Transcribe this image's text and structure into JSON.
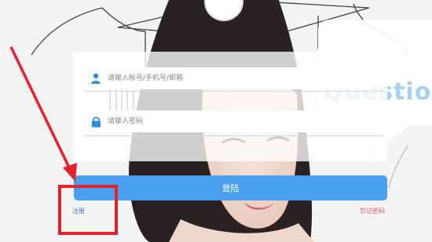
{
  "login_form": {
    "username_placeholder": "请输入帐号/手机号/邮箱",
    "password_placeholder": "请输入密码",
    "login_button": "登陆",
    "register_link": "注册",
    "forgot_password_link": "忘记密码"
  },
  "background": {
    "bubble_text": "Question"
  },
  "colors": {
    "accent": "#4a9ff0",
    "register_link": "#3a78c8",
    "forgot_link": "#e05a5a",
    "annotation": "#e8202a"
  },
  "icons": {
    "username": "user-icon",
    "password": "lock-icon"
  }
}
